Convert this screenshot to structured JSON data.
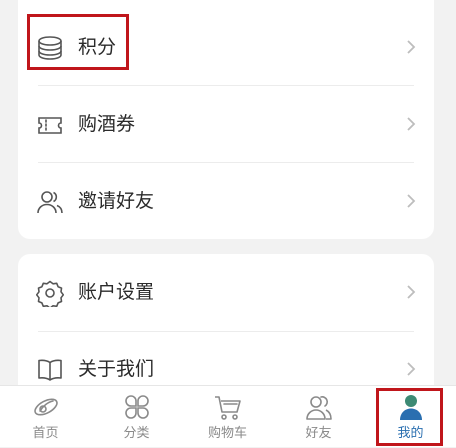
{
  "menu_group_1": {
    "items": [
      {
        "label": "积分",
        "icon": "points-coins-icon"
      },
      {
        "label": "购酒券",
        "icon": "coupon-ticket-icon"
      },
      {
        "label": "邀请好友",
        "icon": "invite-friends-icon"
      }
    ]
  },
  "menu_group_2": {
    "items": [
      {
        "label": "账户设置",
        "icon": "gear-icon"
      },
      {
        "label": "关于我们",
        "icon": "open-book-icon"
      }
    ]
  },
  "tabbar": {
    "tabs": [
      {
        "label": "首页",
        "icon": "home-icon",
        "active": false
      },
      {
        "label": "分类",
        "icon": "category-icon",
        "active": false
      },
      {
        "label": "购物车",
        "icon": "cart-icon",
        "active": false
      },
      {
        "label": "好友",
        "icon": "friends-icon",
        "active": false
      },
      {
        "label": "我的",
        "icon": "profile-icon",
        "active": true
      }
    ]
  },
  "colors": {
    "accent": "#2a6fb0",
    "highlight": "#c0161b",
    "background": "#f2f2f2",
    "profile_head": "#3d8a74",
    "profile_body": "#2a6fb0"
  }
}
